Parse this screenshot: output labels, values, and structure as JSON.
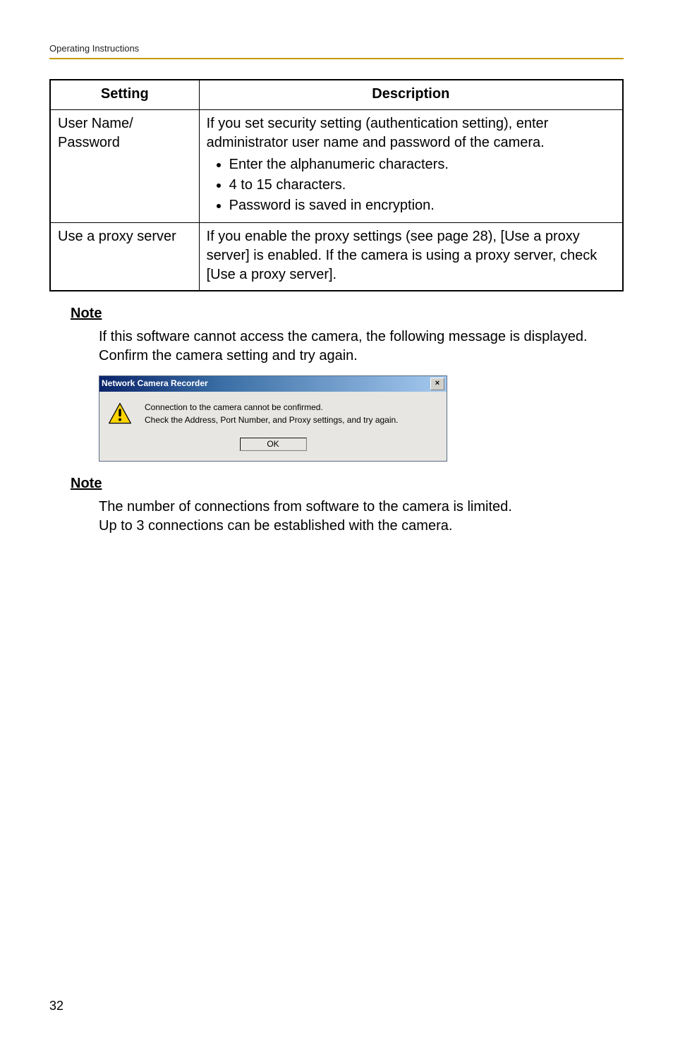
{
  "running_head": "Operating Instructions",
  "table": {
    "headers": {
      "setting": "Setting",
      "description": "Description"
    },
    "rows": [
      {
        "setting": "User Name/\nPassword",
        "description_intro": "If you set security setting (authentication setting), enter administrator user name and password of the camera.",
        "bullets": [
          "Enter the alphanumeric characters.",
          "4 to 15 characters.",
          "Password is saved in encryption."
        ]
      },
      {
        "setting": "Use a proxy server",
        "description": "If you enable the proxy settings (see page 28), [Use a proxy server] is enabled. If the camera is using a proxy server, check [Use a proxy server]."
      }
    ]
  },
  "notes": [
    {
      "heading": "Note",
      "body": "If this software cannot access the camera, the following message is displayed. Confirm the camera setting and try again."
    },
    {
      "heading": "Note",
      "lines": [
        "The number of connections from software to the camera is limited.",
        "Up to 3 connections can be established with the camera."
      ]
    }
  ],
  "dialog": {
    "title": "Network Camera Recorder",
    "line1": "Connection to the camera cannot be confirmed.",
    "line2": "Check the Address, Port Number, and Proxy settings, and try again.",
    "ok": "OK",
    "close_symbol": "×"
  },
  "page_number": "32"
}
